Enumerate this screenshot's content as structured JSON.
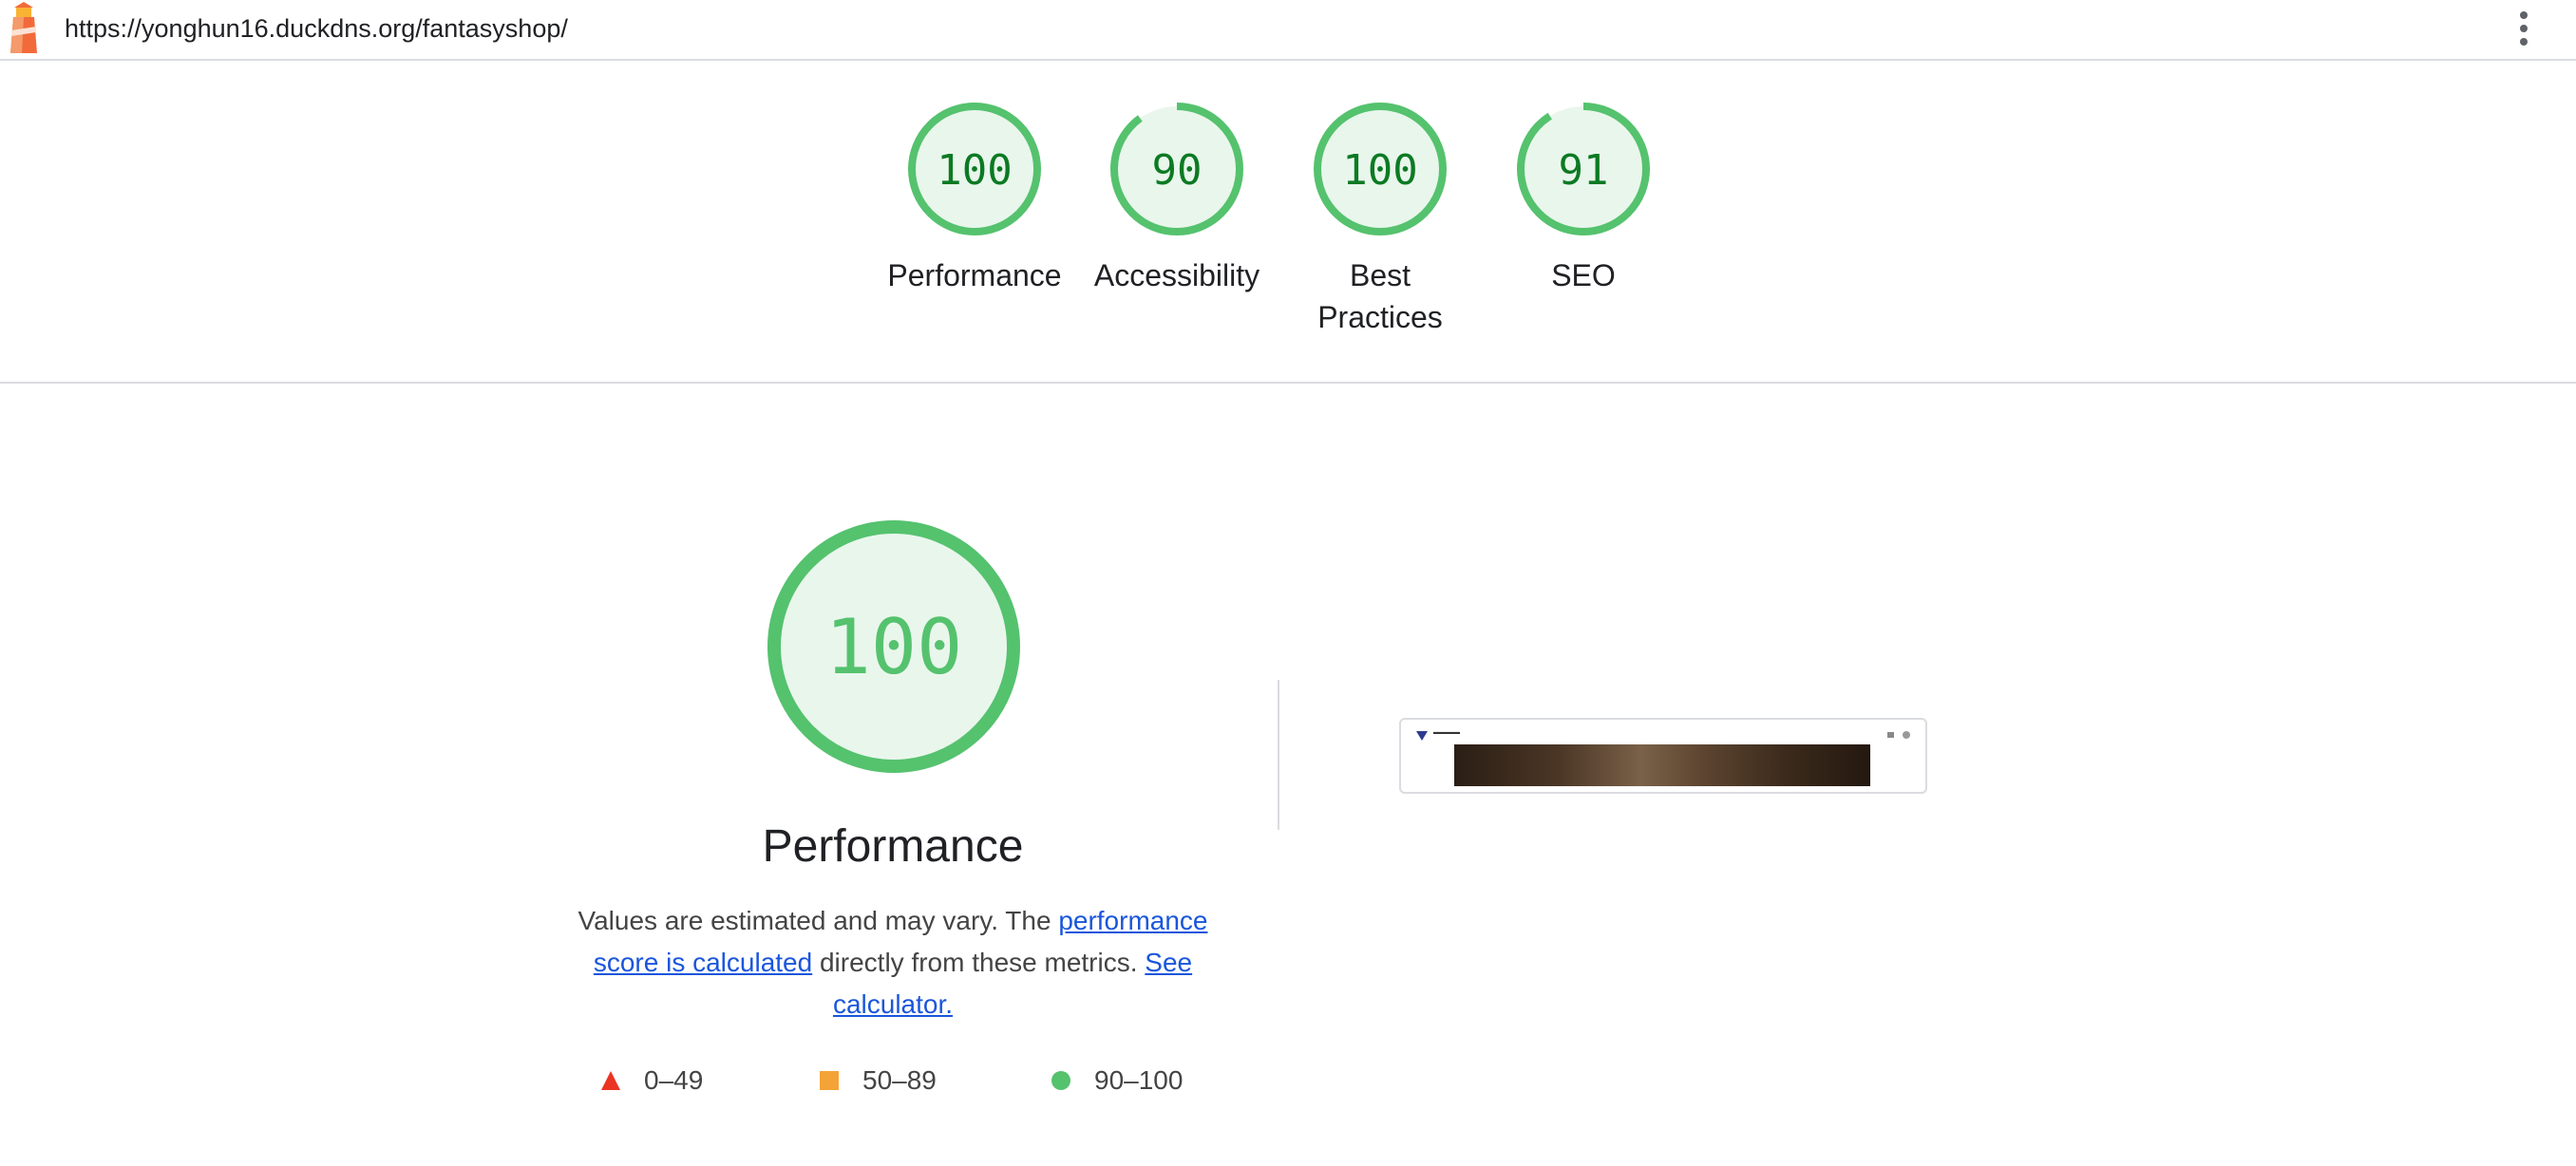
{
  "topbar": {
    "url": "https://yonghun16.duckdns.org/fantasyshop/"
  },
  "gauges": [
    {
      "score": "100",
      "score_value": 100,
      "label": "Performance"
    },
    {
      "score": "90",
      "score_value": 90,
      "label": "Accessibility"
    },
    {
      "score": "100",
      "score_value": 100,
      "label": "Best Practices"
    },
    {
      "score": "91",
      "score_value": 91,
      "label": "SEO"
    }
  ],
  "performance": {
    "score": "100",
    "score_value": 100,
    "title": "Performance",
    "desc_text_1": "Values are estimated and may vary. The ",
    "desc_link_1": "performance score is calculated",
    "desc_text_2": " directly from these metrics. ",
    "desc_link_2": "See calculator."
  },
  "legend": [
    {
      "range": "0–49",
      "symbol": "triangle-icon",
      "color": "#eb3323"
    },
    {
      "range": "50–89",
      "symbol": "square-icon",
      "color": "#f4a336"
    },
    {
      "range": "90–100",
      "symbol": "circle-icon",
      "color": "#55c26e"
    }
  ],
  "colors": {
    "pass_stroke": "#55c26e",
    "pass_fill": "#e9f6ec",
    "pass_text": "#0c7a23",
    "link": "#1a56db"
  }
}
